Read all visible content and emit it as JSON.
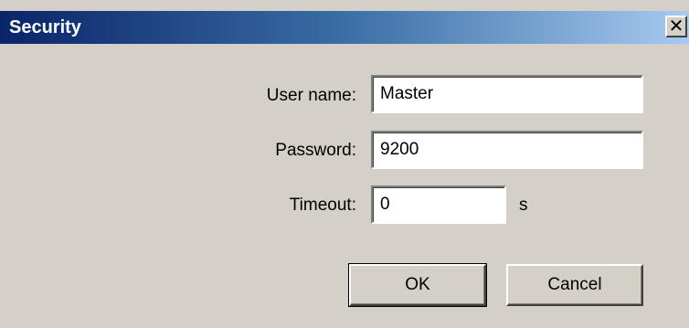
{
  "dialog": {
    "title": "Security",
    "close_glyph": "✕"
  },
  "fields": {
    "username": {
      "label": "User name:",
      "value": "Master"
    },
    "password": {
      "label": "Password:",
      "value": "9200"
    },
    "timeout": {
      "label": "Timeout:",
      "value": "0",
      "unit": "s"
    }
  },
  "buttons": {
    "ok": "OK",
    "cancel": "Cancel"
  },
  "icons": {
    "close": "close-icon"
  }
}
